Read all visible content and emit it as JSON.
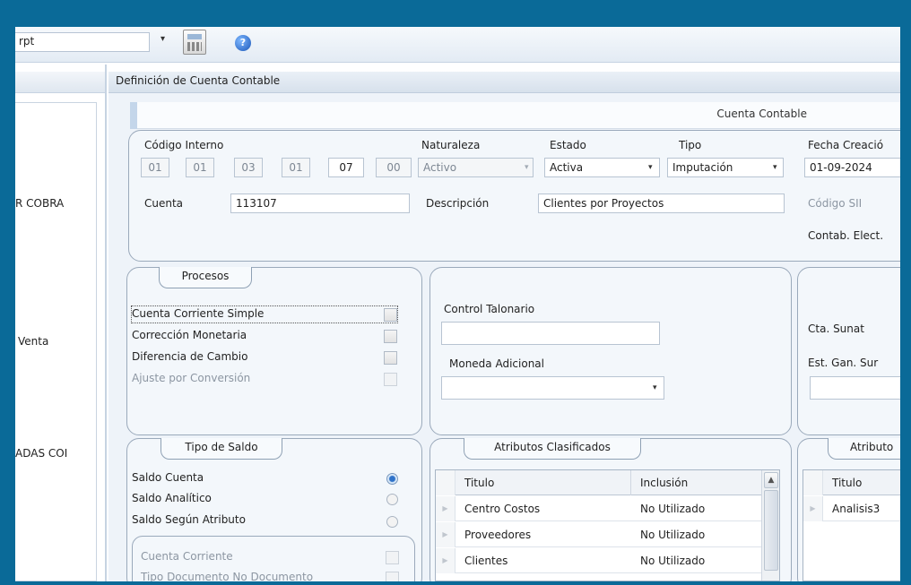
{
  "toolbar": {
    "report_combo_value": "rpt",
    "dropdown_glyph": "▾",
    "help_glyph": "?"
  },
  "left_list": {
    "items": [
      "R COBRA",
      "Venta",
      "ADAS COI"
    ]
  },
  "window": {
    "title": "Definición de Cuenta Contable",
    "tab": "Cuenta Contable"
  },
  "header_group": {
    "codigo_interno_label": "Código Interno",
    "codigo_segments": [
      "01",
      "01",
      "03",
      "01",
      "07",
      "00"
    ],
    "naturaleza_label": "Naturaleza",
    "naturaleza_value": "Activo",
    "estado_label": "Estado",
    "estado_value": "Activa",
    "tipo_label": "Tipo",
    "tipo_value": "Imputación",
    "fecha_creacion_label": "Fecha Creació",
    "fecha_creacion_value": "01-09-2024",
    "cuenta_label": "Cuenta",
    "cuenta_value": "113107",
    "descripcion_label": "Descripción",
    "descripcion_value": "Clientes por Proyectos",
    "codigo_sii_label": "Código SII",
    "contab_elect_label": "Contab. Elect."
  },
  "procesos": {
    "title": "Procesos",
    "items": [
      {
        "label": "Cuenta Corriente Simple",
        "checked": false,
        "enabled": true
      },
      {
        "label": "Corrección Monetaria",
        "checked": false,
        "enabled": true
      },
      {
        "label": "Diferencia de Cambio",
        "checked": false,
        "enabled": true
      },
      {
        "label": "Ajuste por Conversión",
        "checked": false,
        "enabled": false
      }
    ]
  },
  "talonario": {
    "control_label": "Control Talonario",
    "control_value": "",
    "moneda_label": "Moneda Adicional",
    "moneda_value": ""
  },
  "sunat": {
    "cta_sunat_label": "Cta. Sunat",
    "est_gan_label": "Est. Gan. Sur"
  },
  "tipo_saldo": {
    "title": "Tipo de Saldo",
    "options": [
      {
        "label": "Saldo Cuenta",
        "selected": true
      },
      {
        "label": "Saldo Analítico",
        "selected": false
      },
      {
        "label": "Saldo Según Atributo",
        "selected": false
      }
    ],
    "sub_item_label": "Cuenta Corriente",
    "sub_item_cut_label": "Tipo Documento No Documento"
  },
  "atributos_clasificados": {
    "title": "Atributos Clasificados",
    "columns": [
      "Titulo",
      "Inclusión"
    ],
    "rows": [
      [
        "Centro Costos",
        "No Utilizado"
      ],
      [
        "Proveedores",
        "No Utilizado"
      ],
      [
        "Clientes",
        "No Utilizado"
      ]
    ]
  },
  "atributos_right": {
    "title": "Atributo",
    "columns": [
      "Titulo"
    ],
    "rows": [
      [
        "Analisis3"
      ]
    ]
  }
}
